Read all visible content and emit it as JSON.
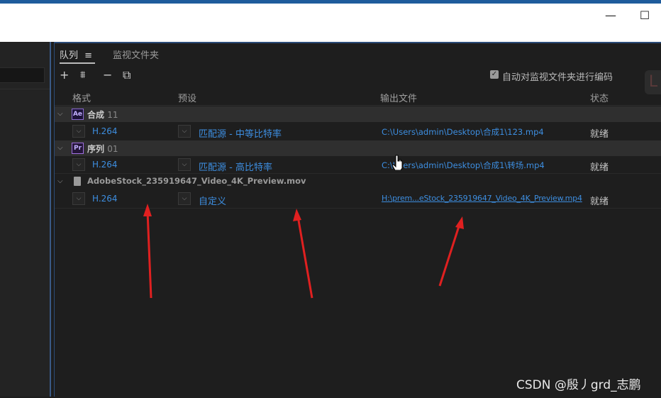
{
  "window": {
    "minimize_icon": "—",
    "maximize_icon": "☐"
  },
  "tabs": [
    {
      "label": "队列",
      "menu_icon": "≡"
    },
    {
      "label": "监视文件夹"
    }
  ],
  "toolbar": {
    "add": "+",
    "settings": "⩩",
    "remove": "−",
    "duplicate": "⧉"
  },
  "auto_encode": {
    "checked": true,
    "label": "自动对监视文件夹进行编码"
  },
  "columns": {
    "format": "格式",
    "preset": "预设",
    "output": "输出文件",
    "status": "状态"
  },
  "groups": [
    {
      "badge": "Ae",
      "name": "合成",
      "suffix": "11",
      "item": {
        "format": "H.264",
        "preset": "匹配源 - 中等比特率",
        "output": "C:\\Users\\admin\\Desktop\\合成1\\123.mp4",
        "status": "就绪"
      }
    },
    {
      "badge": "Pr",
      "name": "序列",
      "suffix": "01",
      "item": {
        "format": "H.264",
        "preset": "匹配源 - 高比特率",
        "output": "C:\\Users\\admin\\Desktop\\合成1\\转场.mp4",
        "status": "就绪"
      }
    },
    {
      "badge": "",
      "name": "AdobeStock_235919647_Video_4K_Preview.mov",
      "suffix": "",
      "item": {
        "format": "H.264",
        "preset": "自定义",
        "output": "H:\\prem...eStock_235919647_Video_4K_Preview.mp4",
        "status": "就绪"
      }
    }
  ],
  "watermark": "CSDN @殷丿grd_志鹏",
  "colors": {
    "accent_blue": "#3d8ee0",
    "arrow_red": "#e02020"
  }
}
